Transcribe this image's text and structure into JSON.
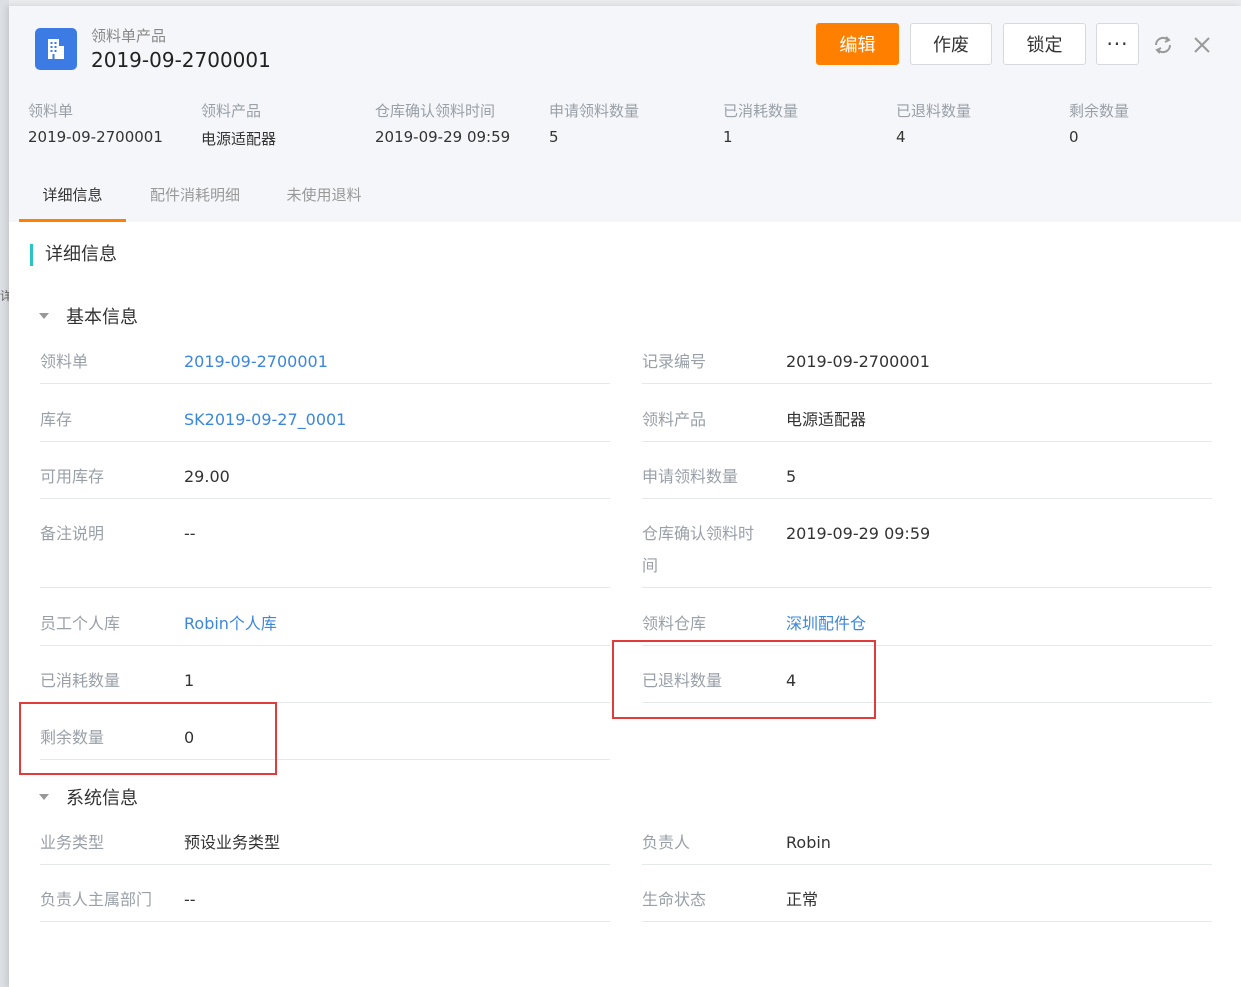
{
  "header": {
    "object_type": "领料单产品",
    "title": "2019-09-2700001",
    "buttons": {
      "edit": "编辑",
      "abandon": "作废",
      "lock": "锁定",
      "more": "···"
    }
  },
  "summary": [
    {
      "label": "领料单",
      "value": "2019-09-2700001"
    },
    {
      "label": "领料产品",
      "value": "电源适配器"
    },
    {
      "label": "仓库确认领料时间",
      "value": "2019-09-29 09:59"
    },
    {
      "label": "申请领料数量",
      "value": "5"
    },
    {
      "label": "已消耗数量",
      "value": "1"
    },
    {
      "label": "已退料数量",
      "value": "4"
    },
    {
      "label": "剩余数量",
      "value": "0"
    }
  ],
  "tabs": [
    {
      "label": "详细信息",
      "active": true
    },
    {
      "label": "配件消耗明细",
      "active": false
    },
    {
      "label": "未使用退料",
      "active": false
    }
  ],
  "section_title": "详细信息",
  "basic_info": {
    "title": "基本信息",
    "fields": {
      "pick_order": {
        "label": "领料单",
        "value": "2019-09-2700001"
      },
      "record_no": {
        "label": "记录编号",
        "value": "2019-09-2700001"
      },
      "stock": {
        "label": "库存",
        "value": "SK2019-09-27_0001"
      },
      "product": {
        "label": "领料产品",
        "value": "电源适配器"
      },
      "available": {
        "label": "可用库存",
        "value": "29.00"
      },
      "apply_qty": {
        "label": "申请领料数量",
        "value": "5"
      },
      "remark": {
        "label": "备注说明",
        "value": "--"
      },
      "confirm_time_line1": "仓库确认领料时",
      "confirm_time_line2": "间",
      "confirm_time_value": "2019-09-29 09:59",
      "personal_store": {
        "label": "员工个人库",
        "value": "Robin个人库"
      },
      "warehouse": {
        "label": "领料仓库",
        "value": "深圳配件仓"
      },
      "consumed": {
        "label": "已消耗数量",
        "value": "1"
      },
      "returned": {
        "label": "已退料数量",
        "value": "4"
      },
      "remaining": {
        "label": "剩余数量",
        "value": "0"
      }
    }
  },
  "system_info": {
    "title": "系统信息",
    "fields": {
      "biz_type": {
        "label": "业务类型",
        "value": "预设业务类型"
      },
      "owner": {
        "label": "负责人",
        "value": "Robin"
      },
      "owner_dept": {
        "label": "负责人主属部门",
        "value": "--"
      },
      "life_status": {
        "label": "生命状态",
        "value": "正常"
      }
    }
  },
  "colors": {
    "accent": "#ff8000",
    "link": "#3b87dc",
    "section_bar": "#2bc4c4",
    "highlight": "#e23b3b",
    "icon_bg": "#3d7be4"
  }
}
